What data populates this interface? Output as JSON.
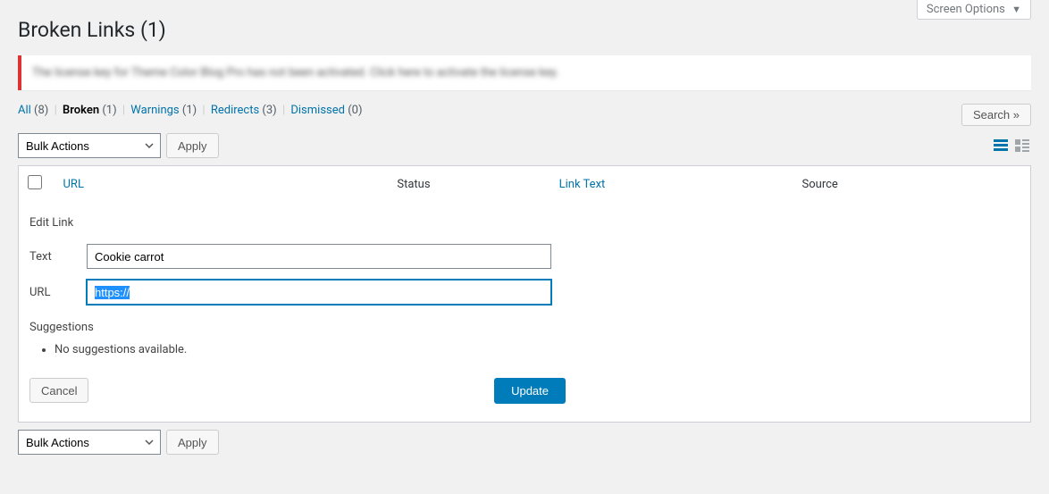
{
  "screen_options": {
    "label": "Screen Options"
  },
  "page_title": "Broken Links (1)",
  "notice": {
    "text": "The license key for Theme Color Blog Pro has not been activated. Click here to activate the license key."
  },
  "filters": {
    "all": {
      "label": "All",
      "count": "(8)"
    },
    "broken": {
      "label": "Broken",
      "count": "(1)"
    },
    "warnings": {
      "label": "Warnings",
      "count": "(1)"
    },
    "redirects": {
      "label": "Redirects",
      "count": "(3)"
    },
    "dismissed": {
      "label": "Dismissed",
      "count": "(0)"
    }
  },
  "search_button": "Search »",
  "bulk_actions": {
    "select_value": "Bulk Actions",
    "apply": "Apply"
  },
  "columns": {
    "url": "URL",
    "status": "Status",
    "link_text": "Link Text",
    "source": "Source"
  },
  "edit_link": {
    "title": "Edit Link",
    "text_label": "Text",
    "text_value": "Cookie carrot",
    "url_label": "URL",
    "url_value": "https://",
    "suggestions_title": "Suggestions",
    "no_suggestions": "No suggestions available.",
    "cancel": "Cancel",
    "update": "Update"
  }
}
